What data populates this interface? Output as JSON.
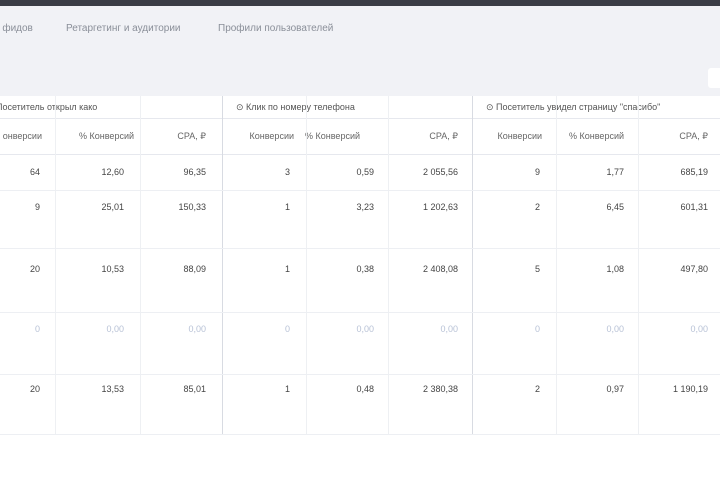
{
  "tabs": [
    "о фидов",
    "Ретаргетинг и аудитории",
    "Профили пользователей"
  ],
  "goals": [
    "Посетитель открыл како",
    "⊙ Клик по номеру телефона",
    "⊙ Посетитель увидел страницу \"спасибо\""
  ],
  "column_headers": [
    "онверсии",
    "% Конверсий",
    "CPA, ₽",
    "Конверсии",
    "% Конверсий",
    "CPA, ₽",
    "Конверсии",
    "% Конверсий",
    "CPA, ₽"
  ],
  "rows": [
    [
      "64",
      "12,60",
      "96,35",
      "3",
      "0,59",
      "2 055,56",
      "9",
      "1,77",
      "685,19"
    ],
    [
      "9",
      "25,01",
      "150,33",
      "1",
      "3,23",
      "1 202,63",
      "2",
      "6,45",
      "601,31"
    ],
    [
      "20",
      "10,53",
      "88,09",
      "1",
      "0,38",
      "2 408,08",
      "5",
      "1,08",
      "497,80"
    ],
    [
      "0",
      "0,00",
      "0,00",
      "0",
      "0,00",
      "0,00",
      "0",
      "0,00",
      "0,00"
    ],
    [
      "20",
      "13,53",
      "85,01",
      "1",
      "0,48",
      "2 380,38",
      "2",
      "0,97",
      "1 190,19"
    ]
  ]
}
